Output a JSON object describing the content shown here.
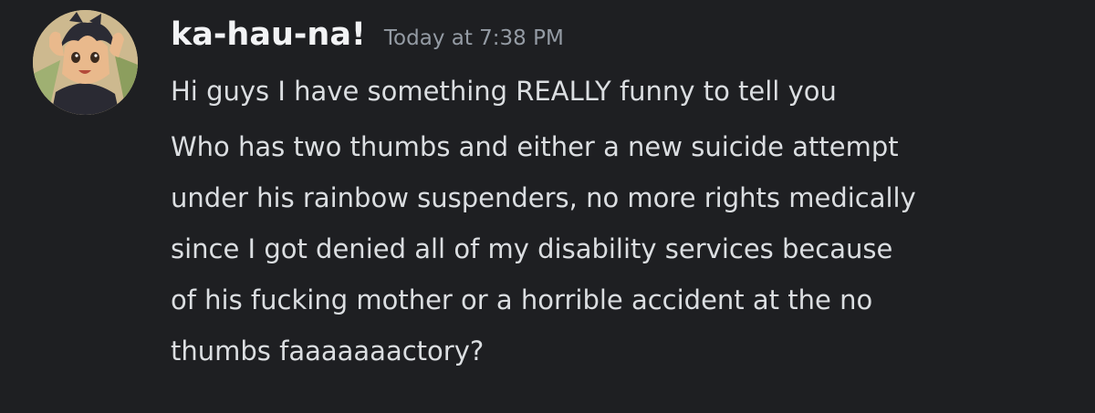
{
  "message": {
    "author": "ka-hau-na!",
    "timestamp": "Today at 7:38 PM",
    "first_line": "Hi guys I have something REALLY funny to tell you",
    "second_message_lines": [
      "Who has two thumbs and either a new suicide attempt",
      "under his rainbow suspenders, no more rights medically",
      "since I got denied all of my disability services because",
      "of his fucking mother or a horrible accident at the no",
      "thumbs faaaaaaactory?"
    ]
  },
  "colors": {
    "background": "#1e1f22",
    "username": "#f2f3f5",
    "timestamp": "#949ba4",
    "text": "#dbdee1"
  },
  "icons": {
    "avatar": "anime-character-avatar"
  }
}
